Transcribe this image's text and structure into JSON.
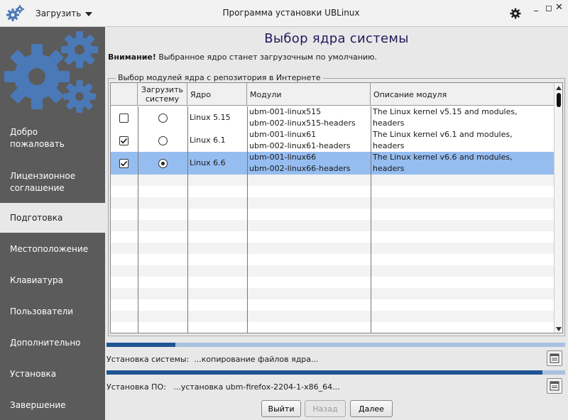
{
  "window": {
    "title": "Программа установки UBLinux",
    "menu_label": "Загрузить"
  },
  "sidebar": {
    "items": [
      {
        "label": "Добро пожаловать",
        "active": false
      },
      {
        "label": "Лицензионное соглашение",
        "active": false
      },
      {
        "label": "Подготовка",
        "active": true
      },
      {
        "label": "Местоположение",
        "active": false
      },
      {
        "label": "Клавиатура",
        "active": false
      },
      {
        "label": "Пользователи",
        "active": false
      },
      {
        "label": "Дополнительно",
        "active": false
      },
      {
        "label": "Установка",
        "active": false
      },
      {
        "label": "Завершение",
        "active": false
      }
    ]
  },
  "main": {
    "title": "Выбор ядра системы",
    "notice_bold": "Внимание!",
    "notice_text": " Выбранное ядро станет загрузочным по умолчанию.",
    "group_label": "Выбор модулей ядра с репозитория в Интернете"
  },
  "table": {
    "headers": {
      "load": "",
      "boot": "Загрузить систему",
      "kernel": "Ядро",
      "modules": "Модули",
      "description": "Описание модуля"
    },
    "rows": [
      {
        "checked": false,
        "boot_selected": false,
        "kernel": "Linux 5.15",
        "module_1": "ubm-001-linux515",
        "module_2": "ubm-002-linux515-headers",
        "desc_1": "The Linux kernel v5.15 and modules,",
        "desc_2": "headers"
      },
      {
        "checked": true,
        "boot_selected": false,
        "kernel": "Linux 6.1",
        "module_1": "ubm-001-linux61",
        "module_2": "ubm-002-linux61-headers",
        "desc_1": "The Linux kernel v6.1 and modules,",
        "desc_2": "headers"
      },
      {
        "checked": true,
        "boot_selected": true,
        "kernel": "Linux 6.6",
        "module_1": "ubm-001-linux66",
        "module_2": "ubm-002-linux66-headers",
        "desc_1": "The Linux kernel v6.6 and modules,",
        "desc_2": "headers"
      }
    ]
  },
  "progress": {
    "system_fraction": 0.15,
    "system_label": "Установка системы:",
    "system_status": "...копирование файлов ядра...",
    "software_fraction": 0.95,
    "software_label": "Установка ПО:",
    "software_status": "...установка ubm-firefox-2204-1-x86_64..."
  },
  "buttons": {
    "exit": "Выйти",
    "back": "Назад",
    "next": "Далее"
  },
  "colors": {
    "sidebar_bg": "#5b5b5b",
    "title_color": "#1e1a5c",
    "selected_row": "#96bdf0",
    "progress_fill": "#1f5593",
    "progress_track": "#a8c2de",
    "logo_gear": "#4a79b8"
  },
  "icons": {
    "app": "gears-icon",
    "settings": "gear-icon",
    "log": "log-icon"
  }
}
